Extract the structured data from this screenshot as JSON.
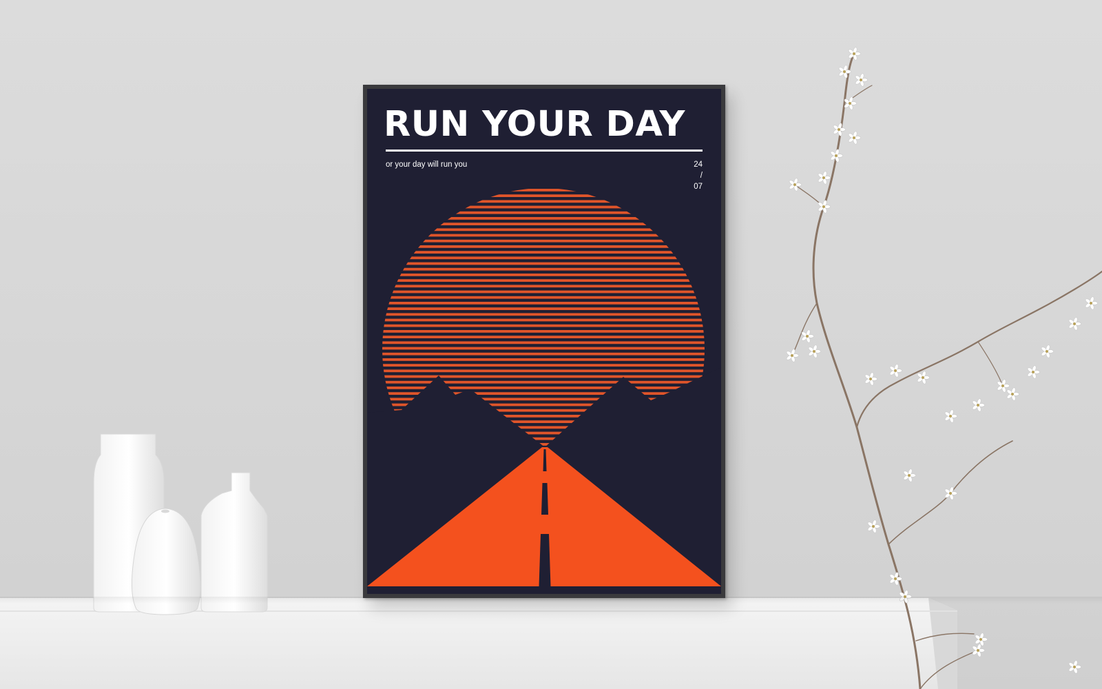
{
  "poster": {
    "title": "RUN YOUR DAY",
    "tagline": "or your day will run you",
    "date": {
      "day": "24",
      "separator": "/",
      "month": "07"
    }
  },
  "colors": {
    "wall": "#dcdcdc",
    "poster_background": "#1f1f33",
    "frame": "#3a3a3d",
    "accent_orange": "#f4511e",
    "stripe_orange": "#e0552a",
    "text": "#ffffff"
  }
}
